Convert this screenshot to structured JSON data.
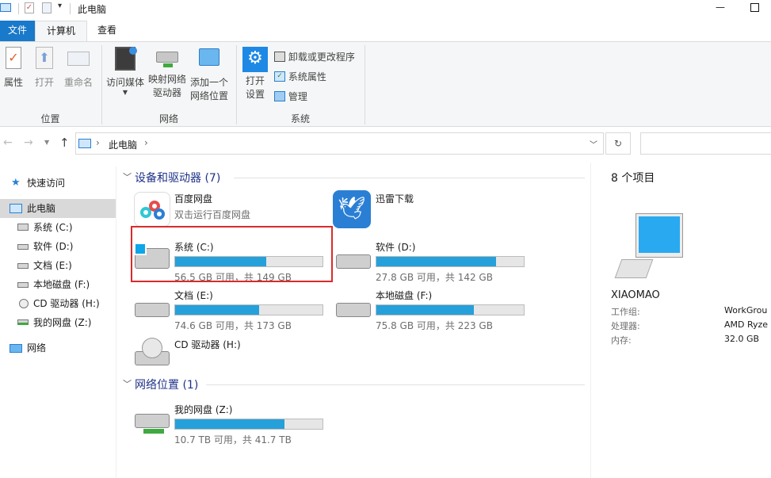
{
  "window": {
    "title": "此电脑",
    "minimize": "—",
    "maximize": "☐"
  },
  "tabs": [
    {
      "label": "文件"
    },
    {
      "label": "计算机"
    },
    {
      "label": "查看"
    }
  ],
  "ribbon": {
    "properties": "属性",
    "open": "打开",
    "rename": "重命名",
    "access_media": "访问媒体",
    "map_network": [
      "映射网络",
      "驱动器"
    ],
    "add_network": [
      "添加一个",
      "网络位置"
    ],
    "open_settings": [
      "打开",
      "设置"
    ],
    "uninstall": "卸载或更改程序",
    "system_props": "系统属性",
    "manage": "管理",
    "groups": {
      "location": "位置",
      "network": "网络",
      "system": "系统"
    }
  },
  "address": {
    "path_root": "此电脑",
    "sep": "›"
  },
  "sidebar": {
    "items": [
      {
        "label": "快速访问"
      },
      {
        "label": "此电脑"
      },
      {
        "label": "系统 (C:)"
      },
      {
        "label": "软件 (D:)"
      },
      {
        "label": "文档 (E:)"
      },
      {
        "label": "本地磁盘 (F:)"
      },
      {
        "label": "CD 驱动器 (H:)"
      },
      {
        "label": "我的网盘 (Z:)"
      },
      {
        "label": "网络"
      }
    ]
  },
  "content": {
    "group_devices": "设备和驱动器 (7)",
    "group_network": "网络位置 (1)",
    "apps": [
      {
        "name": "百度网盘",
        "sub": "双击运行百度网盘"
      },
      {
        "name": "迅雷下载"
      }
    ],
    "drives": [
      {
        "name": "系统 (C:)",
        "info": "56.5 GB 可用，共 149 GB",
        "fill": 0.62
      },
      {
        "name": "软件 (D:)",
        "info": "27.8 GB 可用，共 142 GB",
        "fill": 0.81
      },
      {
        "name": "文档 (E:)",
        "info": "74.6 GB 可用，共 173 GB",
        "fill": 0.57
      },
      {
        "name": "本地磁盘 (F:)",
        "info": "75.8 GB 可用，共 223 GB",
        "fill": 0.66
      },
      {
        "name": "CD 驱动器 (H:)"
      },
      {
        "name": "我的网盘 (Z:)",
        "info": "10.7 TB 可用，共 41.7 TB",
        "fill": 0.74
      }
    ]
  },
  "details": {
    "count": "8 个项目",
    "computer_name": "XIAOMAO",
    "rows": [
      {
        "key": "工作组:",
        "value": "WorkGrou"
      },
      {
        "key": "处理器:",
        "value": "AMD Ryze"
      },
      {
        "key": "内存:",
        "value": "32.0 GB"
      }
    ]
  },
  "colors": {
    "accent": "#1979ca",
    "bar": "#26a0da",
    "highlight": "#d92b2b"
  }
}
